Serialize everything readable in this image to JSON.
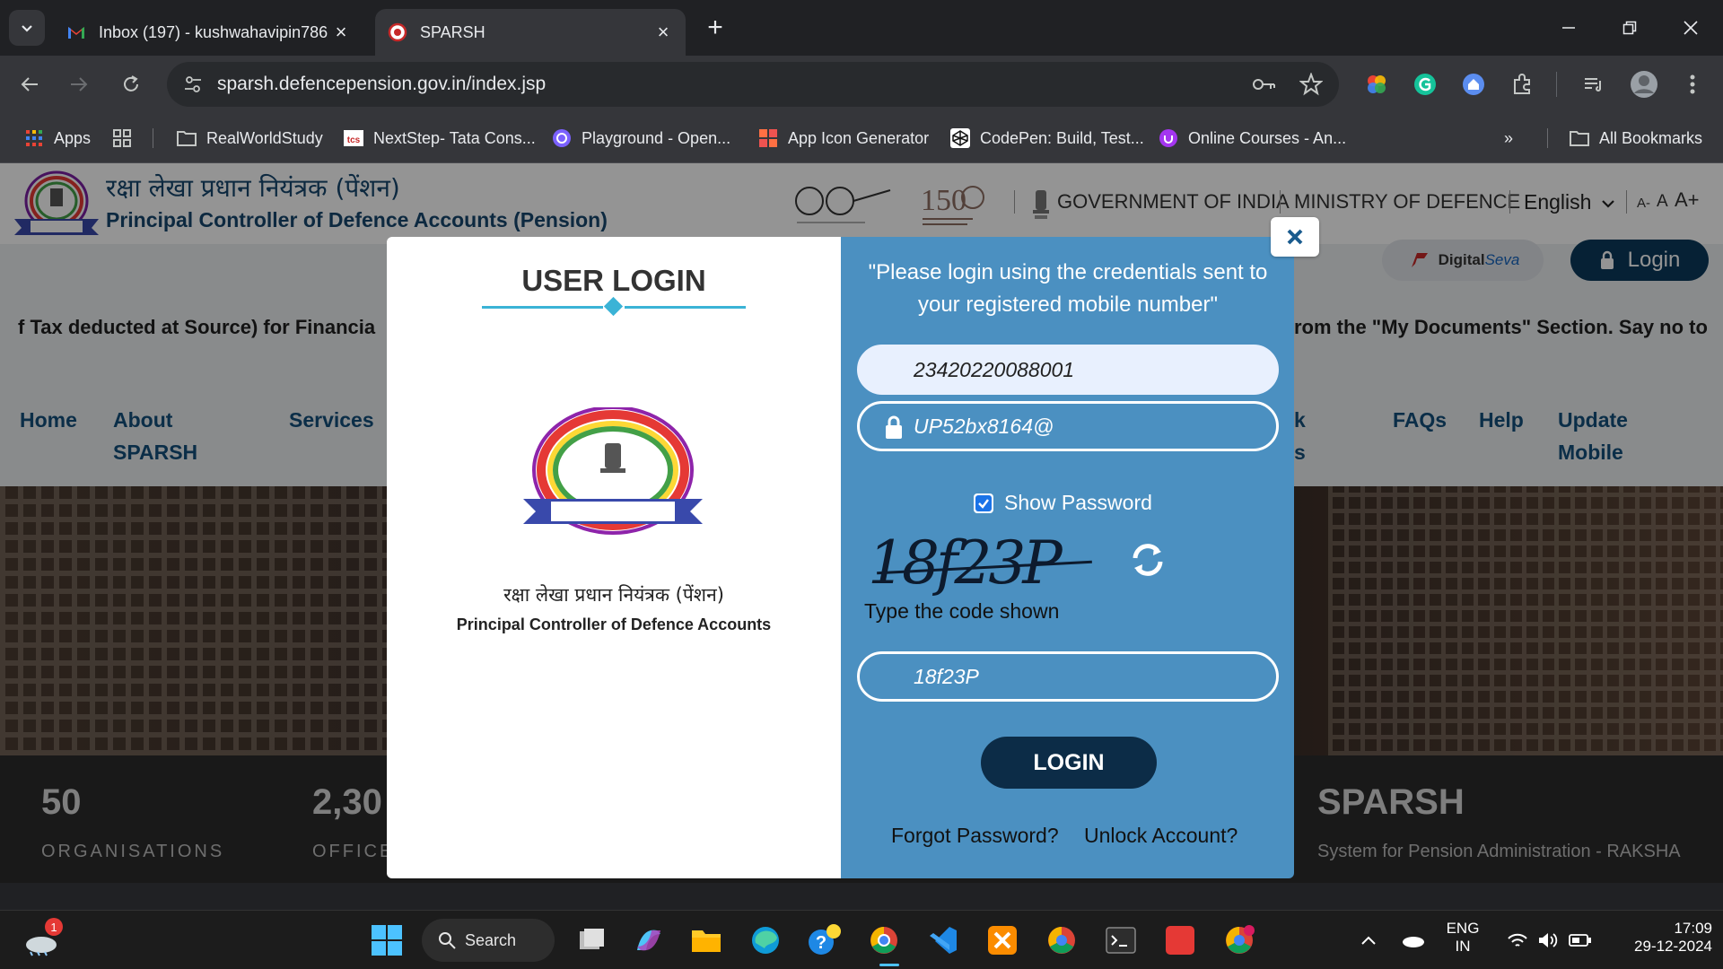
{
  "browser": {
    "tabs": [
      {
        "title": "Inbox (197) - kushwahavipin786",
        "active": false
      },
      {
        "title": "SPARSH",
        "active": true
      }
    ],
    "url": "sparsh.defencepension.gov.in/index.jsp",
    "bookmarks": [
      {
        "label": "Apps",
        "icon": "apps-grid-icon"
      },
      {
        "label": "RealWorldStudy",
        "icon": "folder-icon"
      },
      {
        "label": "NextStep- Tata Cons...",
        "icon": "tcs-icon"
      },
      {
        "label": "Playground - Open...",
        "icon": "openai-icon"
      },
      {
        "label": "App Icon Generator",
        "icon": "app-icon-generator-icon"
      },
      {
        "label": "CodePen: Build, Test...",
        "icon": "codepen-icon"
      },
      {
        "label": "Online Courses - An...",
        "icon": "udemy-icon"
      },
      {
        "label": "All Bookmarks",
        "icon": "folder-icon"
      }
    ]
  },
  "site": {
    "hindi_name": "रक्षा लेखा प्रधान नियंत्रक (पेंशन)",
    "english_name": "Principal Controller of Defence Accounts (Pension)",
    "header_links": [
      "GOVERNMENT OF INDIA",
      "MINISTRY OF DEFENCE"
    ],
    "language": "English",
    "font_sizes": [
      "A-",
      "A",
      "A+"
    ],
    "digital_seva": {
      "bold": "Digital",
      "italic": "Seva"
    },
    "login_label": "Login",
    "marquee_left": "f Tax deducted at Source) for Financia",
    "marquee_right": "rom the \"My Documents\" Section.   Say no to",
    "nav": [
      {
        "label": "Home"
      },
      {
        "label": "About SPARSH"
      },
      {
        "label": "Services"
      },
      {
        "label": "k s"
      },
      {
        "label": "FAQs"
      },
      {
        "label": "Help"
      },
      {
        "label": "Update Mobile"
      }
    ],
    "stats": [
      {
        "value": "50",
        "label": "ORGANISATIONS"
      },
      {
        "value": "2,30",
        "label": "OFFICE"
      }
    ],
    "sparsh_title": "SPARSH",
    "sparsh_sub": "System for Pension Administration - RAKSHA",
    "quick_links": "Quick Links"
  },
  "modal": {
    "title": "USER LOGIN",
    "hindi_org": "रक्षा लेखा प्रधान नियंत्रक (पेंशन)",
    "english_org": "Principal Controller of Defence Accounts",
    "message": "\"Please login using the credentials sent to your registered mobile number\"",
    "username_value": "23420220088001",
    "password_value": "UP52bx8164@",
    "show_password_label": "Show Password",
    "show_password_checked": true,
    "captcha_text": "18f23P",
    "code_label": "Type the code shown",
    "code_value": "18f23P",
    "login_button": "LOGIN",
    "forgot_password": "Forgot Password?",
    "unlock_account": "Unlock Account?"
  },
  "taskbar": {
    "search_label": "Search",
    "weather_badge": "1",
    "language": "ENG",
    "region": "IN",
    "time": "17:09",
    "date": "29-12-2024"
  },
  "colors": {
    "modal_right_bg": "#4b90c1",
    "login_button_bg": "#0c2c47",
    "title_accent": "#3bb3d6",
    "nav_text": "#14507c"
  }
}
